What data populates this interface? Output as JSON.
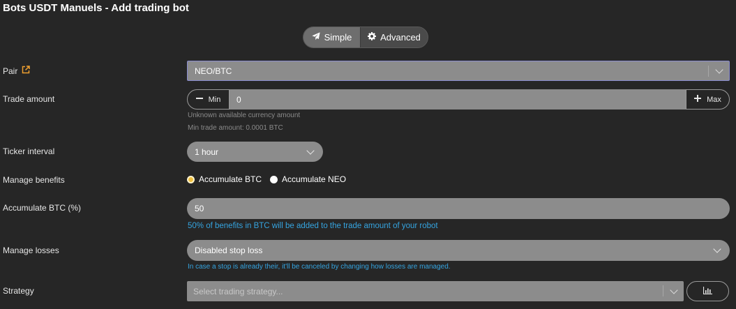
{
  "header": {
    "title": "Bots USDT Manuels - Add trading bot"
  },
  "mode": {
    "simple_label": "Simple",
    "advanced_label": "Advanced",
    "selected": "Simple"
  },
  "pair": {
    "label": "Pair",
    "value": "NEO/BTC"
  },
  "trade_amount": {
    "label": "Trade amount",
    "min_label": "Min",
    "value": "0",
    "max_label": "Max",
    "hint_available": "Unknown available currency amount",
    "hint_min": "Min trade amount: 0.0001 BTC"
  },
  "ticker": {
    "label": "Ticker interval",
    "value": "1 hour"
  },
  "benefits": {
    "label": "Manage benefits",
    "options": [
      "Accumulate BTC",
      "Accumulate NEO"
    ],
    "selected": "Accumulate BTC",
    "option_0": "Accumulate BTC",
    "option_1": "Accumulate NEO"
  },
  "accumulate": {
    "label": "Accumulate BTC (%)",
    "value": "50",
    "info": "50% of benefits in BTC will be added to the trade amount of your robot"
  },
  "losses": {
    "label": "Manage losses",
    "value": "Disabled stop loss",
    "info": "In case a stop is already their, it'll be canceled by changing how losses are managed."
  },
  "strategy": {
    "label": "Strategy",
    "placeholder": "Select trading strategy..."
  },
  "colors": {
    "background": "#262626",
    "field": "#8c8c8c",
    "info_blue": "#35a4e0",
    "external_link": "#f0a030",
    "radio_selected": "#f0c040"
  },
  "icons": {
    "simple": "paper-plane-icon",
    "advanced": "gear-icon",
    "pair_link": "external-link-icon",
    "min": "minus-icon",
    "max": "plus-icon",
    "strategy_chart": "bar-chart-icon"
  }
}
